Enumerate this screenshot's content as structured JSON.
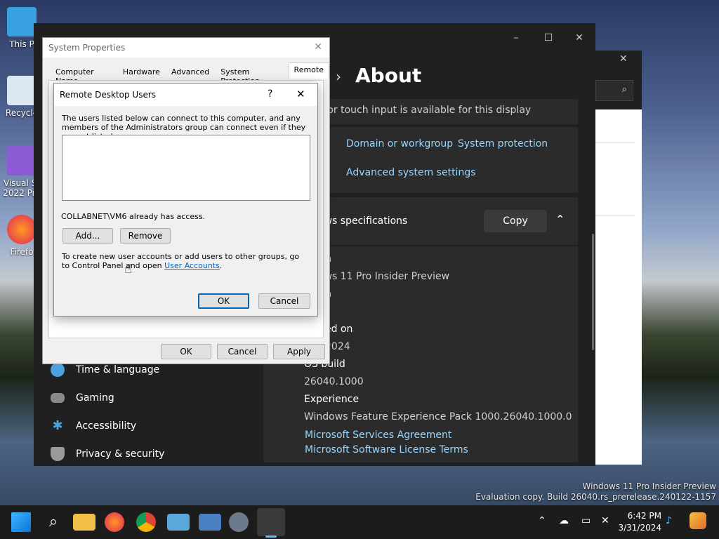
{
  "desktop": {
    "icons": [
      {
        "label": "This P",
        "icon": "monitor-icon"
      },
      {
        "label": "Recycle",
        "icon": "recycle-bin-icon"
      },
      {
        "label": "Visual St\n2022 Pre",
        "icon": "visual-studio-icon"
      },
      {
        "label": "Firefo",
        "icon": "firefox-icon"
      }
    ],
    "watermark_line1": "Windows 11 Pro Insider Preview",
    "watermark_line2": "Evaluation copy. Build 26040.rs_prerelease.240122-1157"
  },
  "settings": {
    "page_title": "About",
    "touch_text": "n or touch input is available for this display",
    "related_links": {
      "domain": "Domain or workgroup",
      "protection": "System protection",
      "advanced": "Advanced system settings"
    },
    "specs_header": "ows specifications",
    "copy_label": "Copy",
    "specs": {
      "edition_label": "n",
      "edition_value": "ows 11 Pro Insider Preview",
      "version_label": "n",
      "installed_label": "ed on",
      "installed_value": "2024",
      "build_label": "OS build",
      "build_value": "26040.1000",
      "experience_label": "Experience",
      "experience_value": "Windows Feature Experience Pack 1000.26040.1000.0",
      "msa_link": "Microsoft Services Agreement",
      "mslt_link": "Microsoft Software License Terms"
    },
    "nav": [
      {
        "label": "Time & language",
        "icon": "globe-clock-icon"
      },
      {
        "label": "Gaming",
        "icon": "gamepad-icon"
      },
      {
        "label": "Accessibility",
        "icon": "accessibility-icon"
      },
      {
        "label": "Privacy & security",
        "icon": "shield-icon"
      }
    ]
  },
  "sysprops": {
    "title": "System Properties",
    "tabs": [
      "Computer Name",
      "Hardware",
      "Advanced",
      "System Protection",
      "Remote"
    ],
    "ok": "OK",
    "cancel": "Cancel",
    "apply": "Apply"
  },
  "rdu": {
    "title": "Remote Desktop Users",
    "help": "?",
    "close": "✕",
    "intro": "The users listed below can connect to this computer, and any members of the Administrators group can connect even if they are not listed.",
    "access_text": "COLLABNET\\VM6 already has access.",
    "add_label": "Add...",
    "remove_label": "Remove",
    "footer_text": "To create new user accounts or add users to other groups, go to Control Panel and open ",
    "footer_link": "User Accounts",
    "footer_end": ".",
    "ok": "OK",
    "cancel": "Cancel"
  },
  "taskbar": {
    "apps": [
      "start-icon",
      "search-icon",
      "file-explorer-icon",
      "firefox-icon",
      "chrome-icon",
      "remote-desktop-icon",
      "network-icon",
      "settings-icon",
      "system-properties-icon"
    ],
    "time": "6:42 PM",
    "date": "3/31/2024"
  }
}
